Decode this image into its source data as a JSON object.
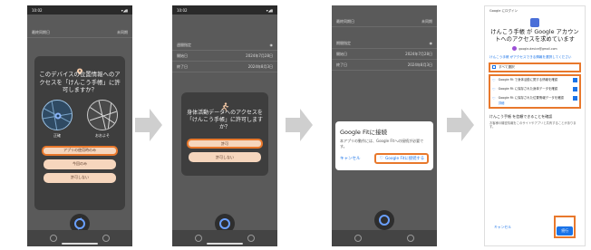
{
  "status": {
    "time": "10:02",
    "time2": "10:03"
  },
  "screen1": {
    "rows": [
      "最終同期日",
      "未同期"
    ],
    "dialog_title": "このデバイスの位置情報へのアクセスを「けんこう手帳」に許可しますか？",
    "opt_precise": "正確",
    "opt_approx": "おおよそ",
    "btn_while_using": "アプリの使用時のみ",
    "btn_once": "今回のみ",
    "btn_deny": "許可しない"
  },
  "screen2": {
    "rows": [
      {
        "label": "週間指定",
        "value": ""
      },
      {
        "label": "開始日",
        "value": "2024年7月28日"
      },
      {
        "label": "終了日",
        "value": "2024年8月3日"
      }
    ],
    "dialog_title": "身体活動データへのアクセスを「けんこう手帳」に許可しますか？",
    "btn_allow": "許可",
    "btn_deny": "許可しない"
  },
  "screen3": {
    "rows": [
      {
        "label": "最終同期日",
        "value": "未同期"
      },
      {
        "label": "期間指定",
        "value": ""
      },
      {
        "label": "開始日",
        "value": "2024年7月28日"
      },
      {
        "label": "終了日",
        "value": "2024年8月3日"
      }
    ],
    "dialog_title": "Google Fitに接続",
    "dialog_body": "本アプリの動作には、Google Fitへの接続が必要です。",
    "btn_cancel": "キャンセル",
    "btn_connect": "Google Fitに接続する"
  },
  "screen4": {
    "header": "Google にログイン",
    "title": "けんこう手帳 が Google アカウントへのアクセスを求めています",
    "account": "google-device@gmail.com",
    "intro": "けんこう手帳 がアクセスできる情報を選択してください",
    "select_all": "すべて選択",
    "perms": [
      "Google Fit で身体活動に関する情報を確認",
      "Google Fit に保存された身体データを確認",
      "Google Fit に保存された位置情報データを確認"
    ],
    "more": "詳細",
    "trust_title": "けんこう手帳 を信頼できることを確認",
    "trust_body": "お客様の機密情報をこのサイトやアプリと共有することがあります。",
    "cancel": "キャンセル",
    "continue": "続行"
  },
  "colors": {
    "highlight": "#e8782c",
    "pill": "#f6d6bd",
    "google_blue": "#1a73e8"
  }
}
